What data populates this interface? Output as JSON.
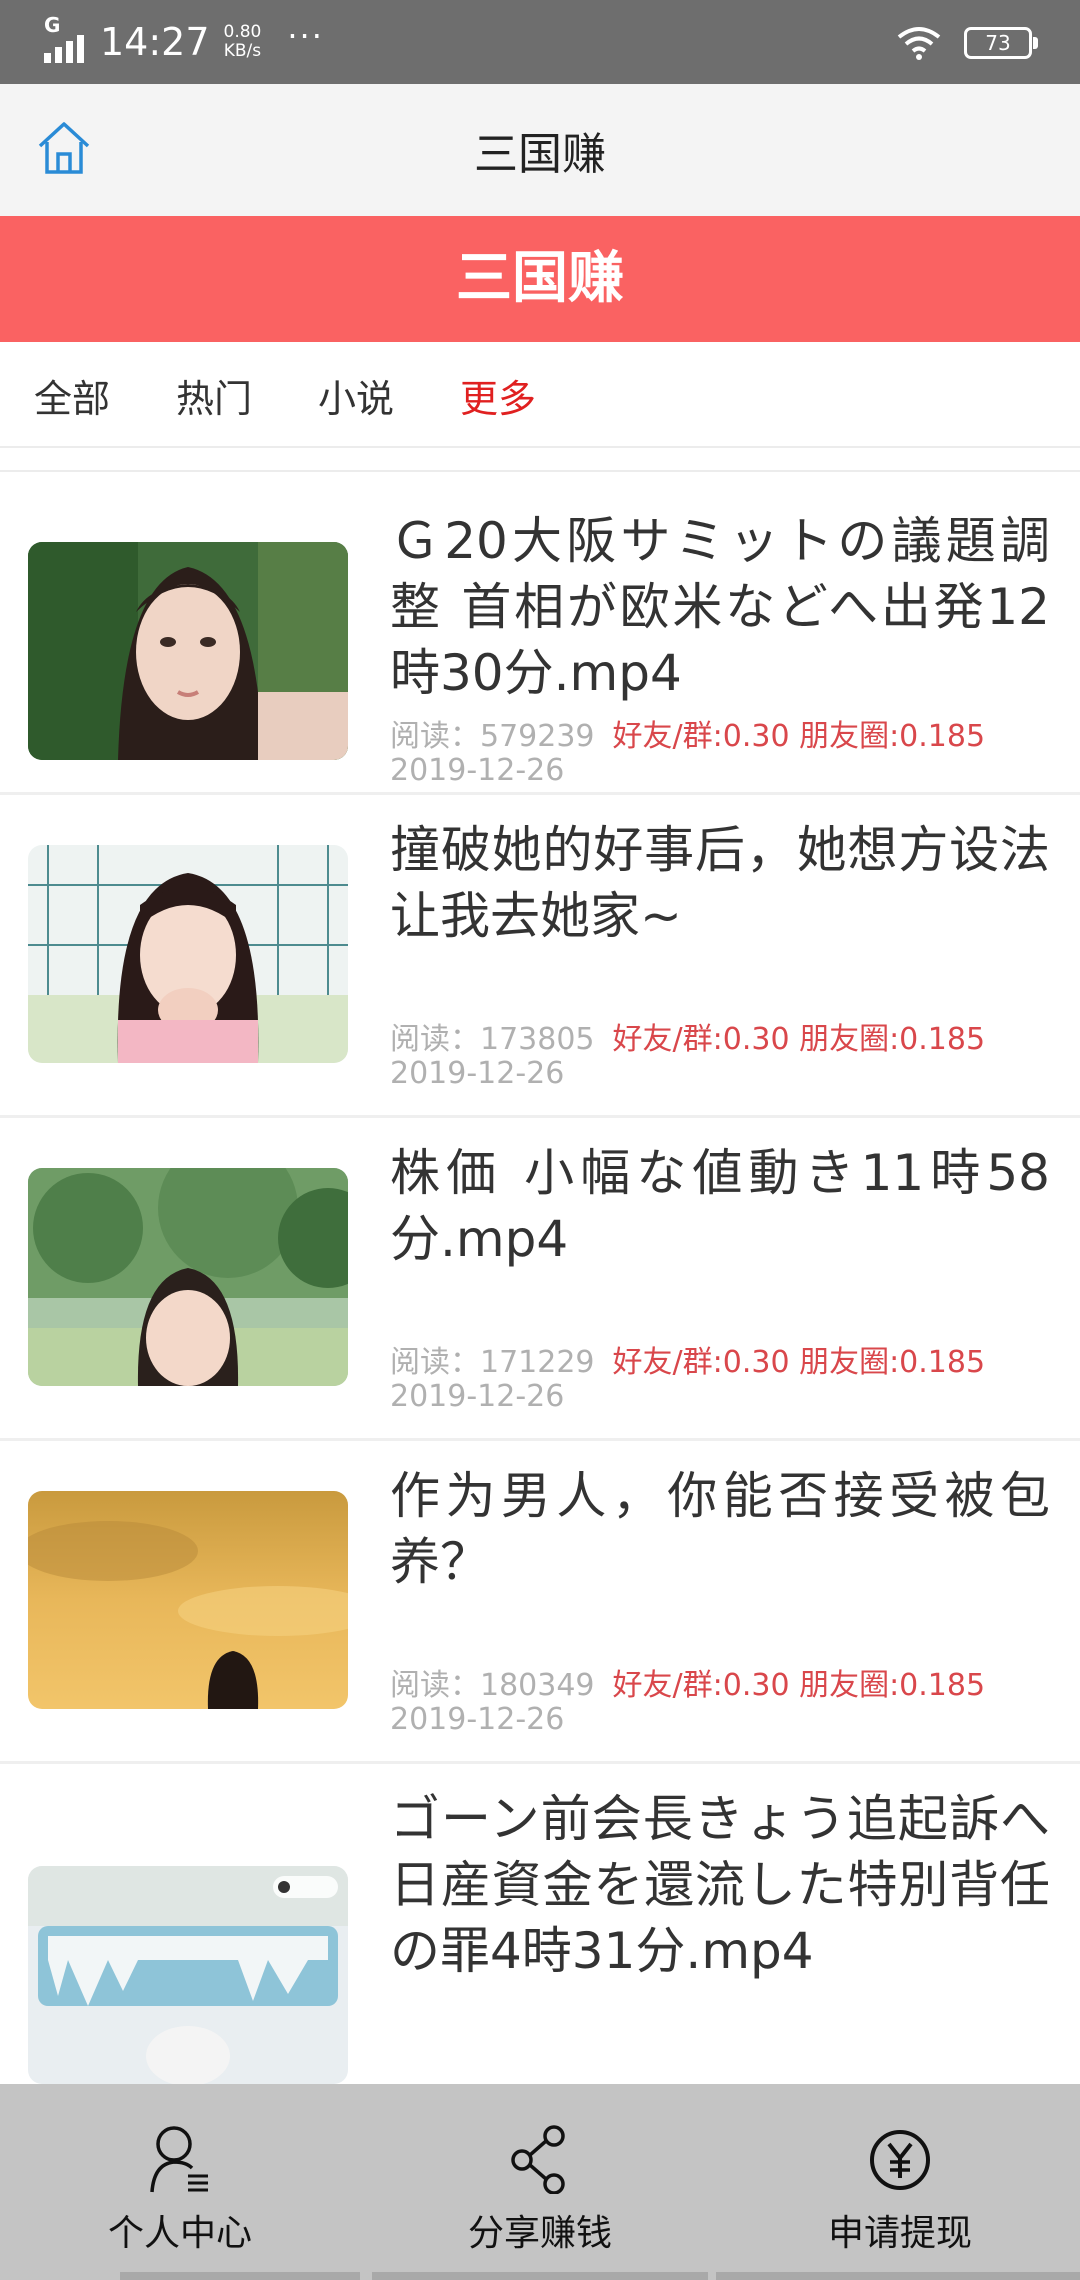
{
  "status_bar": {
    "network": "G",
    "time": "14:27",
    "speed_value": "0.80",
    "speed_unit": "KB/s",
    "more": "···",
    "battery": "73"
  },
  "header": {
    "title": "三国赚"
  },
  "banner": {
    "title": "三国赚"
  },
  "tabs": [
    {
      "label": "全部",
      "active": false
    },
    {
      "label": "热门",
      "active": false
    },
    {
      "label": "小说",
      "active": false
    },
    {
      "label": "更多",
      "active": true
    }
  ],
  "articles": [
    {
      "title": "Ｇ20大阪サミットの議題調整 首相が欧米などへ出発12時30分.mp4",
      "reads": "阅读：579239",
      "reward": "好友/群:0.30 朋友圈:0.185",
      "date": "2019-12-26"
    },
    {
      "title": "撞破她的好事后，她想方设法让我去她家~",
      "reads": "阅读：173805",
      "reward": "好友/群:0.30 朋友圈:0.185",
      "date": "2019-12-26"
    },
    {
      "title": "株価 小幅な値動き11時58分.mp4",
      "reads": "阅读：171229",
      "reward": "好友/群:0.30 朋友圈:0.185",
      "date": "2019-12-26"
    },
    {
      "title": "作为男人，你能否接受被包养？",
      "reads": "阅读：180349",
      "reward": "好友/群:0.30 朋友圈:0.185",
      "date": "2019-12-26"
    },
    {
      "title": "ゴーン前会長きょう追起訴へ 日産資金を還流した特別背任の罪4時31分.mp4",
      "reads": "",
      "reward": "",
      "date": ""
    }
  ],
  "bottom_nav": [
    {
      "label": "个人中心",
      "icon": "user-icon"
    },
    {
      "label": "分享赚钱",
      "icon": "share-icon"
    },
    {
      "label": "申请提现",
      "icon": "yuan-icon"
    }
  ],
  "colors": {
    "accent": "#fa6262",
    "active_tab": "#e02020",
    "reward": "#d9474b",
    "home_icon": "#2a8bd6"
  }
}
